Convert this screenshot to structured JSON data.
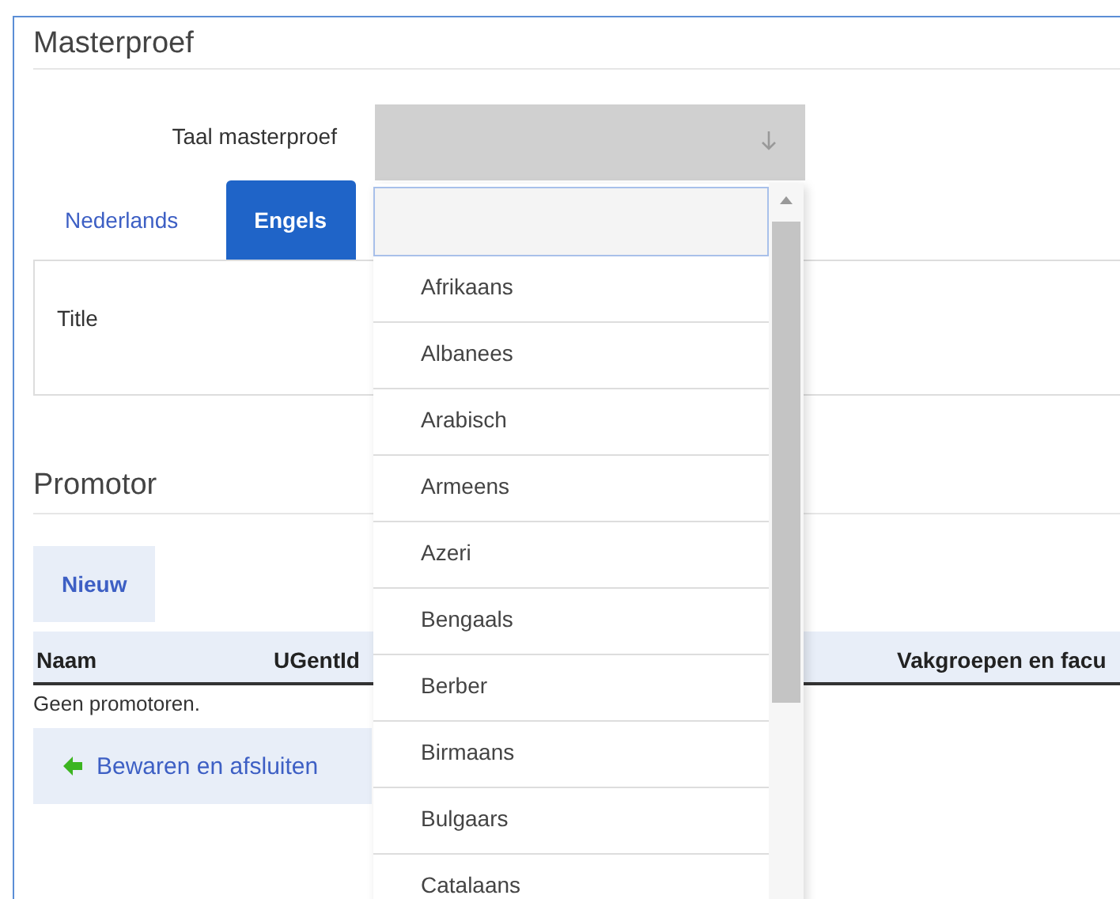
{
  "section_title": "Masterproef",
  "language_field": {
    "label": "Taal masterproef",
    "expanded": true
  },
  "tabs": [
    {
      "label": "Nederlands",
      "selected": false
    },
    {
      "label": "Engels",
      "selected": true
    }
  ],
  "title_field": {
    "label": "Title"
  },
  "promotor": {
    "title": "Promotor",
    "new_button": "Nieuw",
    "columns": [
      "Naam",
      "UGentId",
      "Vakgroepen en facu"
    ],
    "empty_text": "Geen promotoren."
  },
  "save_button": "Bewaren en afsluiten",
  "dropdown_options": [
    "Afrikaans",
    "Albanees",
    "Arabisch",
    "Armeens",
    "Azeri",
    "Bengaals",
    "Berber",
    "Birmaans",
    "Bulgaars",
    "Catalaans"
  ]
}
